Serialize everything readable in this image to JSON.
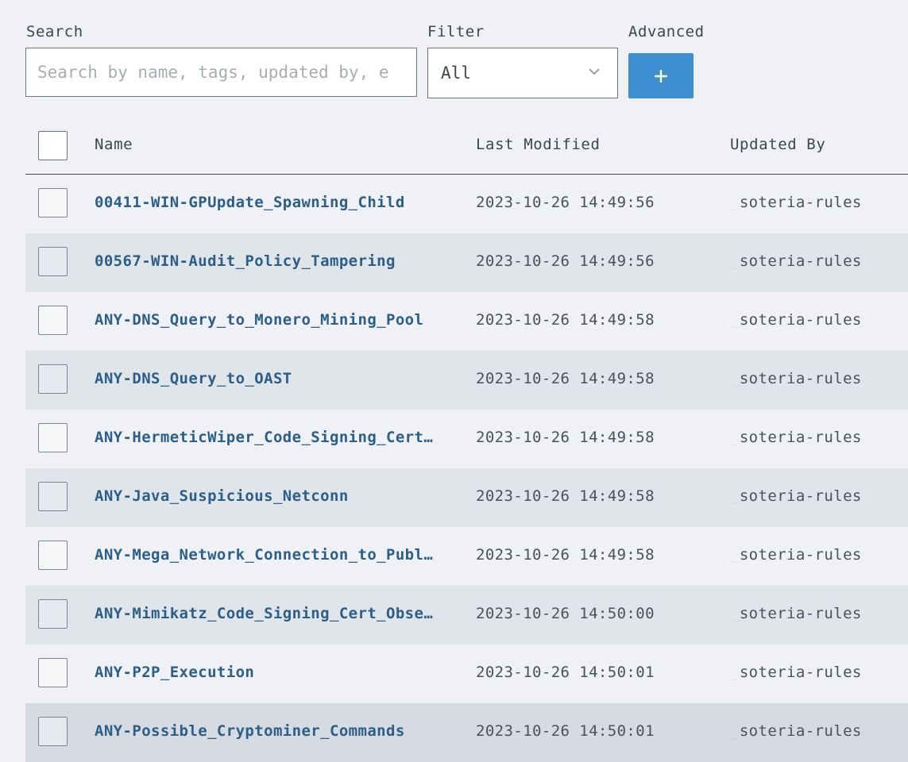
{
  "search": {
    "label": "Search",
    "placeholder": "Search by name, tags, updated by, e",
    "value": ""
  },
  "filter": {
    "label": "Filter",
    "selected": "All"
  },
  "advanced": {
    "label": "Advanced",
    "button_icon": "plus-icon"
  },
  "table": {
    "columns": [
      "Name",
      "Last Modified",
      "Updated By"
    ],
    "rows": [
      {
        "name": "00411-WIN-GPUpdate_Spawning_Child",
        "modified": "2023-10-26 14:49:56",
        "updated_by": "_soteria-rules"
      },
      {
        "name": "00567-WIN-Audit_Policy_Tampering",
        "modified": "2023-10-26 14:49:56",
        "updated_by": "_soteria-rules"
      },
      {
        "name": "ANY-DNS_Query_to_Monero_Mining_Pool",
        "modified": "2023-10-26 14:49:58",
        "updated_by": "_soteria-rules"
      },
      {
        "name": "ANY-DNS_Query_to_OAST",
        "modified": "2023-10-26 14:49:58",
        "updated_by": "_soteria-rules"
      },
      {
        "name": "ANY-HermeticWiper_Code_Signing_Cert…",
        "modified": "2023-10-26 14:49:58",
        "updated_by": "_soteria-rules"
      },
      {
        "name": "ANY-Java_Suspicious_Netconn",
        "modified": "2023-10-26 14:49:58",
        "updated_by": "_soteria-rules"
      },
      {
        "name": "ANY-Mega_Network_Connection_to_Publ…",
        "modified": "2023-10-26 14:49:58",
        "updated_by": "_soteria-rules"
      },
      {
        "name": "ANY-Mimikatz_Code_Signing_Cert_Obse…",
        "modified": "2023-10-26 14:50:00",
        "updated_by": "_soteria-rules"
      },
      {
        "name": "ANY-P2P_Execution",
        "modified": "2023-10-26 14:50:01",
        "updated_by": "_soteria-rules"
      },
      {
        "name": "ANY-Possible_Cryptominer_Commands",
        "modified": "2023-10-26 14:50:01",
        "updated_by": "_soteria-rules"
      }
    ]
  },
  "colors": {
    "accent": "#3e8fd1",
    "link": "#2b5f8a",
    "row_alt": "#e0e5ea",
    "background": "#eff1f4"
  }
}
